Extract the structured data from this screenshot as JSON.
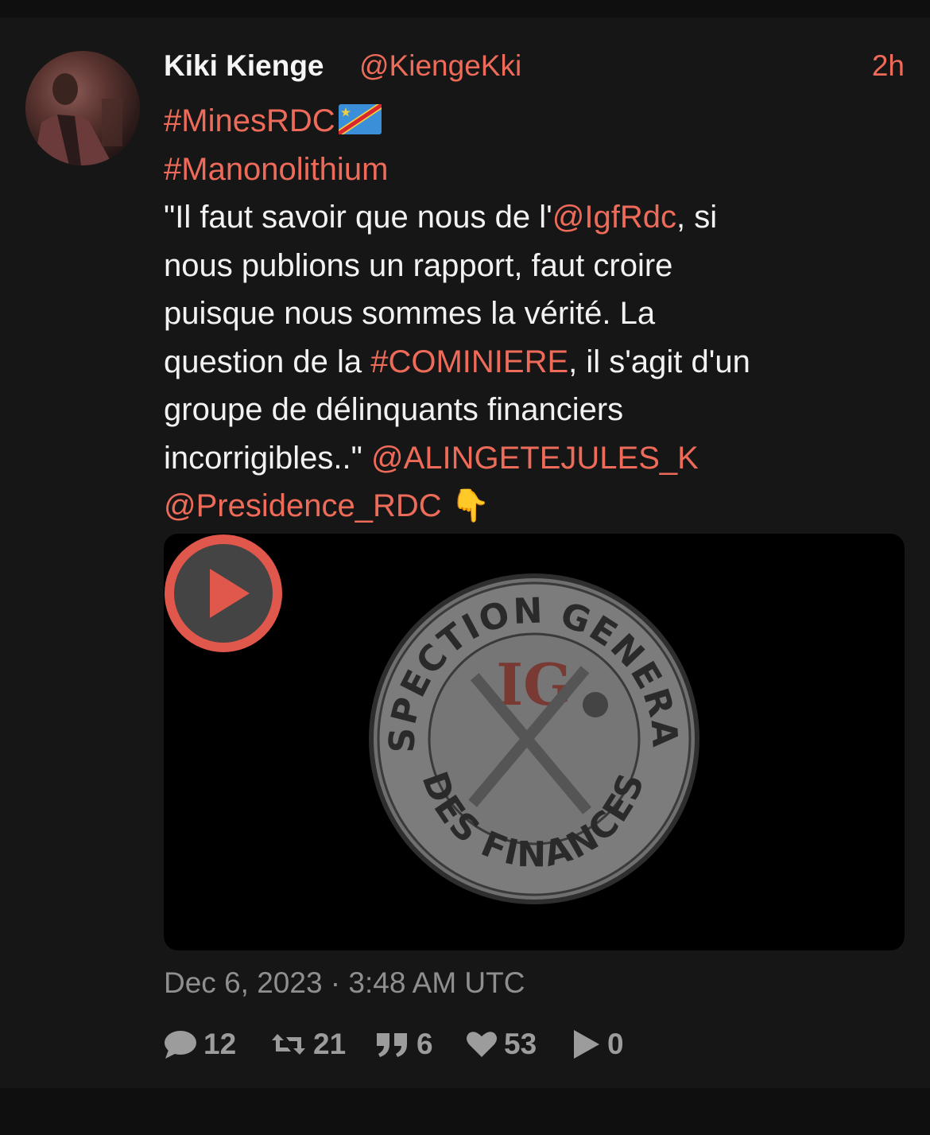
{
  "tweet": {
    "fullname": "Kiki Kienge",
    "username": "@KiengeKki",
    "time_ago": "2h",
    "hashtag1": "#MinesRDC",
    "flag_icon": "flag-drc-icon",
    "hashtag2": "#Manonolithium",
    "line3_pre": "\"Il faut savoir que nous de l'",
    "mention_igf": "@IgfRdc",
    "line3_post": ", si",
    "line4": "nous publions un rapport, faut croire",
    "line5": "puisque nous sommes la vérité. La",
    "line6_pre": "question de la ",
    "hashtag_cominiere": "#COMINIERE",
    "line6_post": ", il s'agit d'un",
    "line7": "groupe de délinquants financiers",
    "line8_pre": "incorrigibles..\" ",
    "mention_alingete": "@ALINGETEJULES_K",
    "mention_presidence": "@Presidence_RDC",
    "emoji": "👇",
    "date": "Dec 6, 2023 · 3:48 AM UTC"
  },
  "video": {
    "seal_top_text": "INSPECTION GENERALE",
    "seal_bottom_text": "DES FINANCES",
    "seal_monogram": "IG",
    "accent_color": "#e0574b"
  },
  "stats": {
    "replies": "12",
    "retweets": "21",
    "quotes": "6",
    "likes": "53",
    "plays": "0"
  },
  "colors": {
    "link": "#ee6b59",
    "background": "#161616",
    "muted": "#9c9c9c"
  }
}
